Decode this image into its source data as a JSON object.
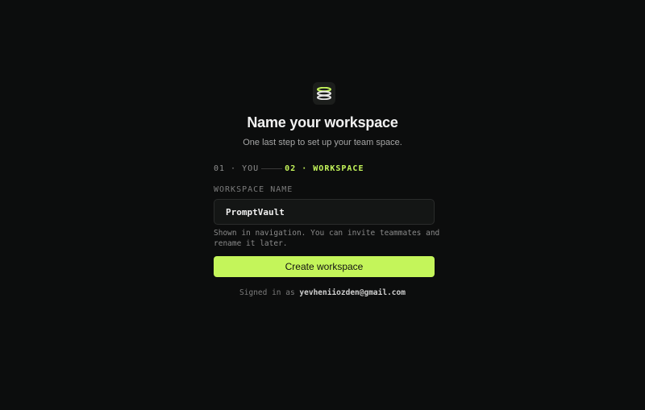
{
  "header": {
    "logo_icon": "stack-icon",
    "title": "Name your workspace",
    "subtitle": "One last step to set up your team space."
  },
  "steps": {
    "step1": "01 · YOU",
    "step2": "02 · WORKSPACE",
    "active_color": "#c4f55a"
  },
  "form": {
    "label": "WORKSPACE NAME",
    "value": "PromptVault",
    "hint": "Shown in navigation. You can invite teammates and rename it later.",
    "submit_label": "Create workspace",
    "accent": "#c4f55a"
  },
  "footer": {
    "prefix": "Signed in as",
    "email": "yevheniiozden@gmail.com"
  }
}
